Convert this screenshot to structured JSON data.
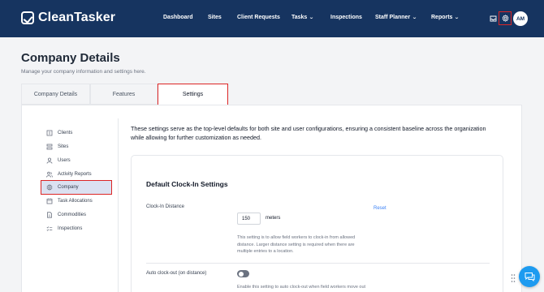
{
  "app": {
    "name": "CleanTasker"
  },
  "nav": {
    "items": [
      {
        "label": "Dashboard",
        "has_dropdown": false
      },
      {
        "label": "Sites",
        "has_dropdown": false
      },
      {
        "label": "Client Requests",
        "has_dropdown": false
      },
      {
        "label": "Tasks",
        "has_dropdown": true
      },
      {
        "label": "Inspections",
        "has_dropdown": false
      },
      {
        "label": "Staff Planner",
        "has_dropdown": true
      },
      {
        "label": "Reports",
        "has_dropdown": true
      }
    ],
    "icons": [
      "inbox-icon",
      "gear-icon"
    ],
    "avatar_initials": "AM"
  },
  "page": {
    "title": "Company Details",
    "subtitle": "Manage your company information and settings here."
  },
  "tabs": [
    {
      "label": "Company Details",
      "active": false
    },
    {
      "label": "Features",
      "active": false
    },
    {
      "label": "Settings",
      "active": true
    }
  ],
  "sidebar": {
    "items": [
      {
        "label": "Clients",
        "icon": "building-icon"
      },
      {
        "label": "Sites",
        "icon": "stack-icon"
      },
      {
        "label": "Users",
        "icon": "user-icon"
      },
      {
        "label": "Activity Reports",
        "icon": "users-icon"
      },
      {
        "label": "Company",
        "icon": "gear-icon",
        "selected": true
      },
      {
        "label": "Task Allocations",
        "icon": "calendar-icon"
      },
      {
        "label": "Commodities",
        "icon": "document-icon"
      },
      {
        "label": "Inspections",
        "icon": "checklist-icon"
      }
    ]
  },
  "settings": {
    "intro": "These settings serve as the top-level defaults for both site and user configurations, ensuring a consistent baseline across the organization while allowing for further customization as needed.",
    "section_title": "Default Clock-In Settings",
    "clock_in_distance": {
      "label": "Clock-In Distance",
      "value": "150",
      "unit": "meters",
      "reset_label": "Reset",
      "help": "This setting is to allow field workers to clock-in from allowed distance. Larger distance setting is required when there are multiple entries to a location."
    },
    "auto_clock_out": {
      "label": "Auto clock-out (on distance)",
      "enabled": false,
      "help": "Enable this setting to auto clock-out when field workers move out of the location."
    }
  },
  "colors": {
    "nav_bg": "#163460",
    "highlight_border": "#dc2626",
    "selected_bg": "#dbe1f1",
    "link": "#3b82f6",
    "chat_fab": "#1d9bf0"
  },
  "chat": {
    "icon": "chat-icon"
  }
}
